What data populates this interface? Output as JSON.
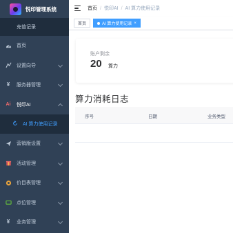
{
  "sidebar": {
    "brand": "悦印管理系统",
    "recharge": "充值记录",
    "items": [
      {
        "label": "首页",
        "icon": "dashboard-icon"
      },
      {
        "label": "设置向导",
        "icon": "guide-icon"
      },
      {
        "label": "服务器管理",
        "icon": "yen-icon"
      },
      {
        "label": "悦印AI",
        "icon": "ai-icon"
      },
      {
        "label": "营销版设置",
        "icon": "send-icon"
      },
      {
        "label": "活动管理",
        "icon": "gift-icon"
      },
      {
        "label": "价目表管理",
        "icon": "price-icon"
      },
      {
        "label": "点位管理",
        "icon": "location-icon"
      },
      {
        "label": "业务管理",
        "icon": "business-icon"
      }
    ],
    "active_sub": "AI 算力使用记录"
  },
  "breadcrumb": {
    "home": "首页",
    "level1": "悦印AI",
    "level2": "AI 算力使用记录",
    "sep": "/"
  },
  "tags": {
    "home": "首页",
    "current": "AI 算力使用记录",
    "close": "×"
  },
  "summary": {
    "label": "账户剩余",
    "value": "20",
    "unit": "算力"
  },
  "log": {
    "title": "算力消耗日志",
    "columns": [
      "序号",
      "日期",
      "业务类型"
    ]
  },
  "colors": {
    "sidebar_bg": "#304156",
    "accent": "#409eff"
  }
}
